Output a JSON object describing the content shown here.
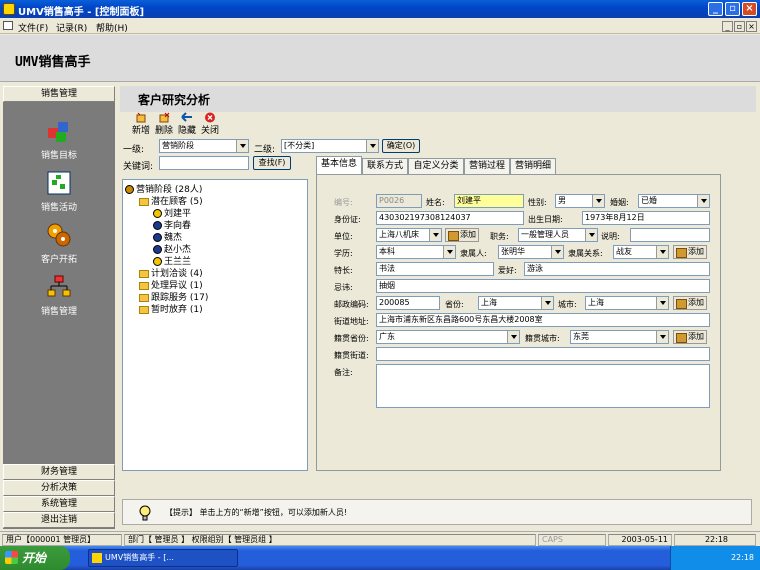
{
  "window": {
    "title": "UMV销售高手 - [控制面板]"
  },
  "menu": [
    "文件(F)",
    "记录(R)",
    "帮助(H)"
  ],
  "header": {
    "app_name": "UMV销售高手"
  },
  "sidebar": {
    "top_section": "销售管理",
    "items": [
      "销售目标",
      "销售活动",
      "客户开拓",
      "销售管理"
    ],
    "bottom_sections": [
      "财务管理",
      "分析决策",
      "系统管理",
      "退出注销"
    ]
  },
  "page": {
    "title": "客户研究分析"
  },
  "toolbar": [
    "新增",
    "删除",
    "隐藏",
    "关闭"
  ],
  "filter": {
    "level1_label": "一级:",
    "level1_value": "营销阶段",
    "level2_label": "二级:",
    "level2_value": "[不分类]",
    "confirm": "确定(O)",
    "keyword_label": "关键词:",
    "keyword_value": "",
    "search": "查找(F)"
  },
  "tabs": [
    "基本信息",
    "联系方式",
    "自定义分类",
    "营销过程",
    "营销明细"
  ],
  "tree": {
    "root": "营销阶段 (28人)",
    "groups": [
      {
        "label": "潜在顾客 (5)",
        "people": [
          "刘建平",
          "李向春",
          "魏杰",
          "赵小杰",
          "王兰兰"
        ]
      },
      {
        "label": "计划洽谈 (4)"
      },
      {
        "label": "处理异议 (1)"
      },
      {
        "label": "跟踪服务 (17)"
      },
      {
        "label": "暂时放弃 (1)"
      }
    ]
  },
  "form": {
    "id_label": "编号:",
    "id_value": "P0026",
    "name_label": "姓名:",
    "name_value": "刘建平",
    "gender_label": "性别:",
    "gender_value": "男",
    "marriage_label": "婚姻:",
    "marriage_value": "已婚",
    "idcard_label": "身份证:",
    "idcard_value": "430302197308124037",
    "birth_label": "出生日期:",
    "birth_value": "1973年8月12日",
    "unit_label": "单位:",
    "unit_value": "上海八机床",
    "add": "添加",
    "post_label": "职务:",
    "post_value": "一般管理人员",
    "note_label": "说明:",
    "note_value": "",
    "edu_label": "学历:",
    "edu_value": "本科",
    "belong_label": "隶属人:",
    "belong_value": "张明华",
    "relation_label": "隶属关系:",
    "relation_value": "战友",
    "skill_label": "特长:",
    "skill_value": "书法",
    "hobby_label": "爱好:",
    "hobby_value": "游泳",
    "taboo_label": "忌讳:",
    "taboo_value": "抽烟",
    "zip_label": "邮政编码:",
    "zip_value": "200085",
    "prov_label": "省份:",
    "prov_value": "上海",
    "city_label": "城市:",
    "city_value": "上海",
    "street_label": "街道地址:",
    "street_value": "上海市浦东新区东昌路600号东昌大楼2008室",
    "native_prov_label": "籍贯省份:",
    "native_prov_value": "广东",
    "native_city_label": "籍贯城市:",
    "native_city_value": "东莞",
    "native_street_label": "籍贯街道:",
    "native_street_value": "",
    "remark_label": "备注:",
    "remark_value": ""
  },
  "tip": {
    "text": "【提示】 单击上方的“新增”按钮，可以添加新人员!"
  },
  "status": {
    "user": "用户【000001 管理员】",
    "dept": "部门【 管理员 】 权限组别【 管理员组 】",
    "caps": "CAPS",
    "date": "2003-05-11",
    "time": "22:18"
  },
  "taskbar": {
    "start": "开始",
    "task": "UMV销售高手 - [...",
    "clock": "22:18"
  }
}
